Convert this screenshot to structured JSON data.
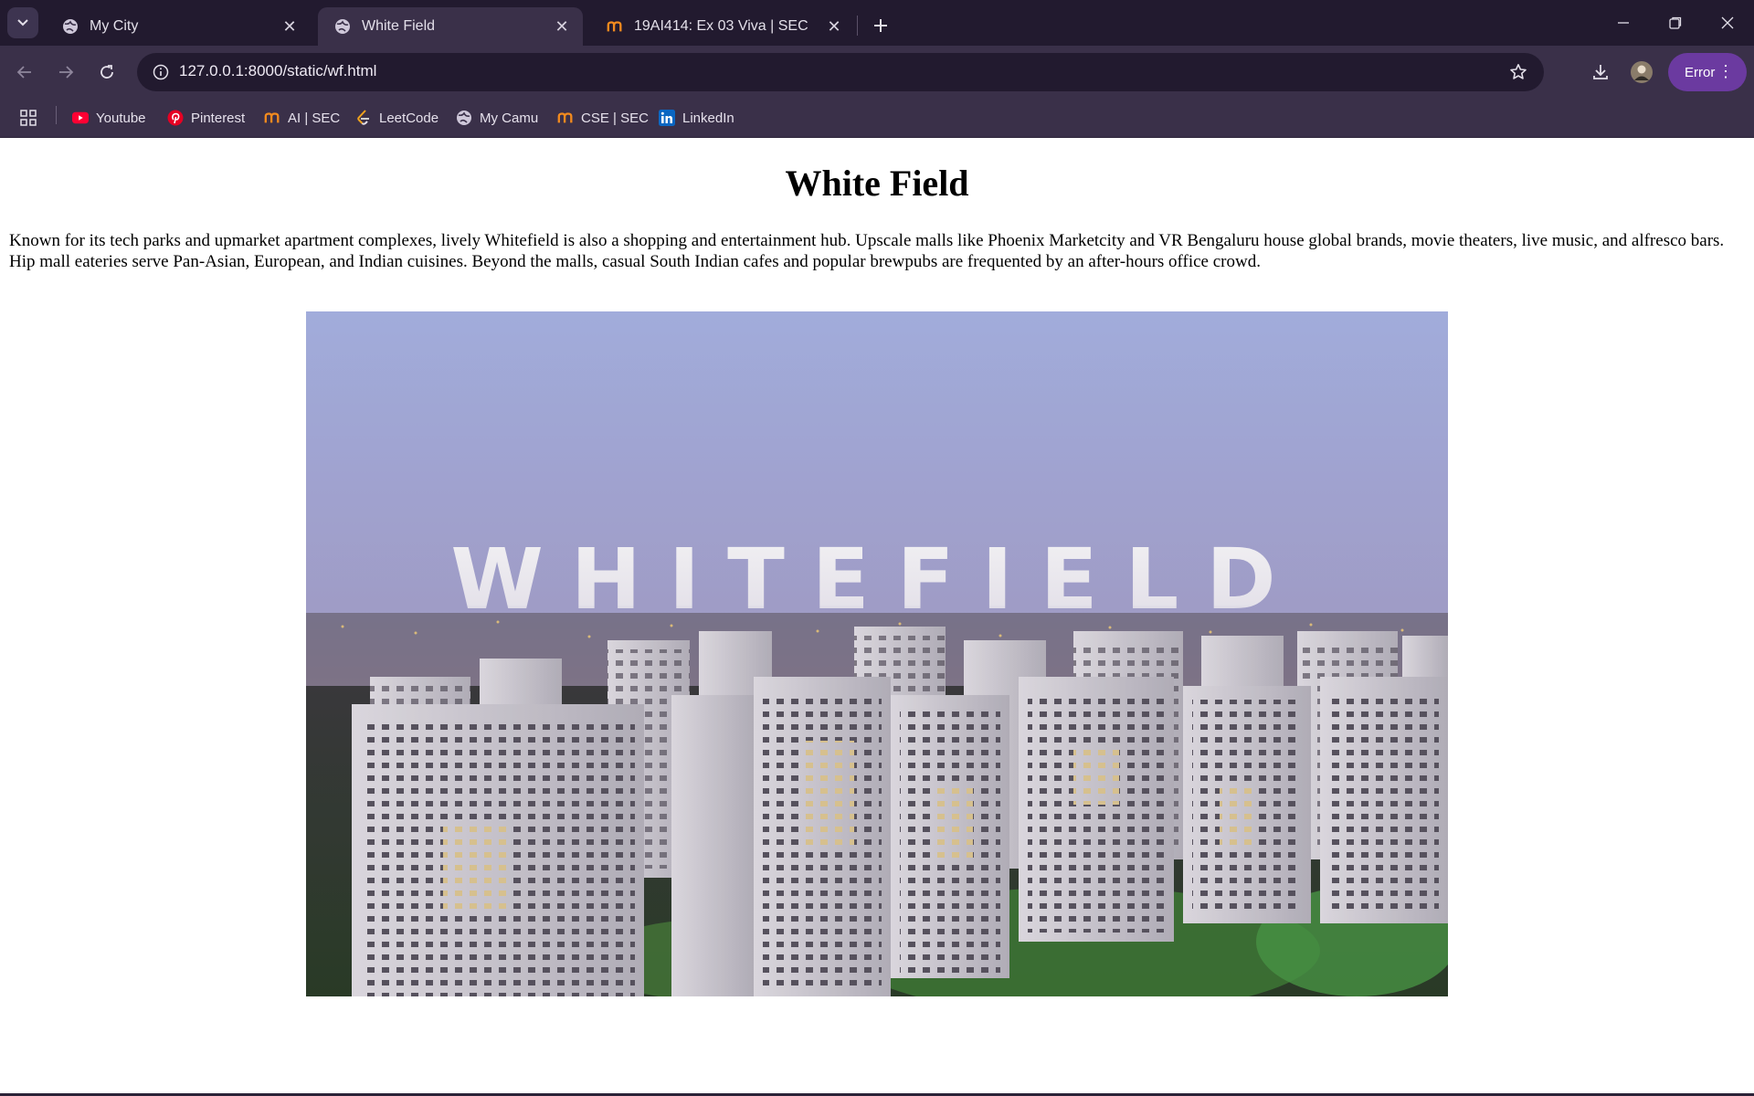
{
  "browser": {
    "tabs": [
      {
        "title": "My City",
        "icon": "globe-icon",
        "active": false
      },
      {
        "title": "White Field",
        "icon": "globe-icon",
        "active": true
      },
      {
        "title": "19AI414: Ex 03 Viva | SEC",
        "icon": "moodle-icon",
        "active": false
      }
    ],
    "address": "127.0.0.1:8000/static/wf.html",
    "profile_status": "Error",
    "accent": "#6b3aa0"
  },
  "bookmarks": [
    {
      "label": "Youtube",
      "icon": "youtube-icon"
    },
    {
      "label": "Pinterest",
      "icon": "pinterest-icon"
    },
    {
      "label": "AI | SEC",
      "icon": "moodle-icon"
    },
    {
      "label": "LeetCode",
      "icon": "leetcode-icon"
    },
    {
      "label": "My Camu",
      "icon": "globe-icon"
    },
    {
      "label": "CSE | SEC",
      "icon": "moodle-icon"
    },
    {
      "label": "LinkedIn",
      "icon": "linkedin-icon"
    }
  ],
  "page": {
    "heading": "White Field",
    "description": "Known for its tech parks and upmarket apartment complexes, lively Whitefield is also a shopping and entertainment hub. Upscale malls like Phoenix Marketcity and VR Bengaluru house global brands, movie theaters, live music, and alfresco bars. Hip mall eateries serve Pan-Asian, European, and Indian cuisines. Beyond the malls, casual South Indian cafes and popular brewpubs are frequented by an after-hours office crowd.",
    "image_caption": "WHITEFIELD"
  }
}
